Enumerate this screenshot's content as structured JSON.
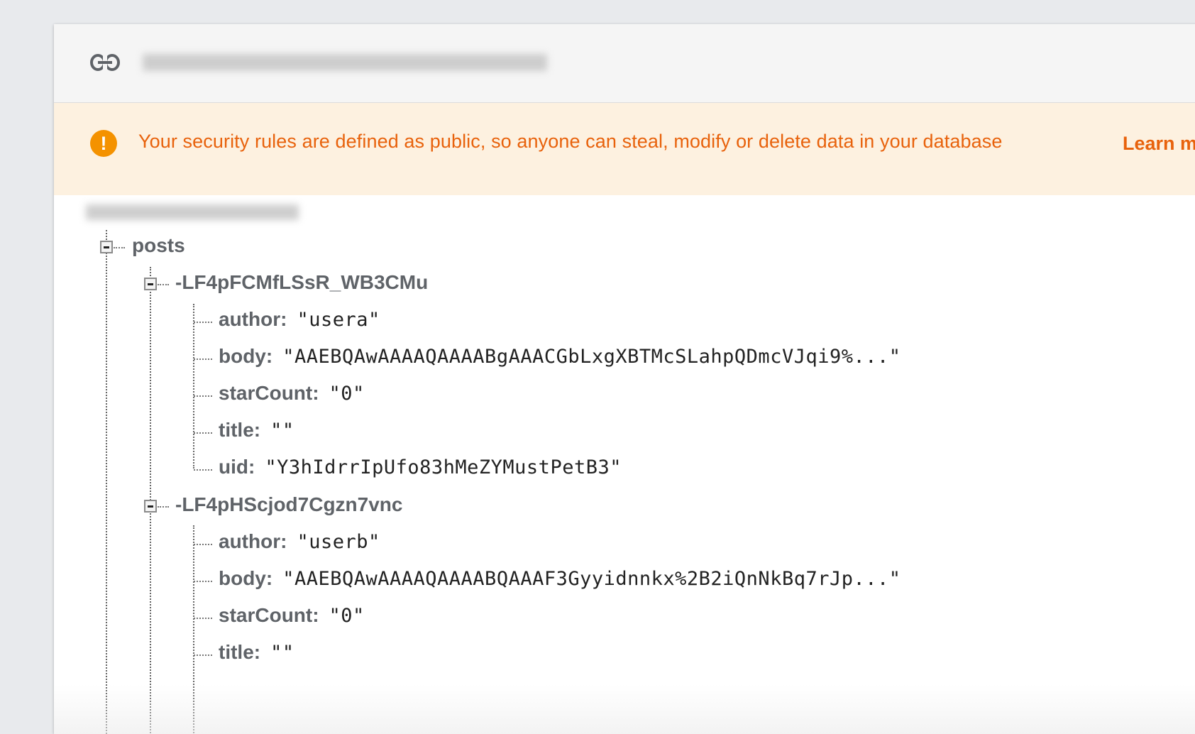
{
  "warning": {
    "icon": "exclamation-icon",
    "message": "Your security rules are defined as public, so anyone can steal, modify or delete data in your database",
    "learn_more": "Learn m",
    "color": "#e8620c",
    "background": "#fdf1e0",
    "icon_color": "#f49200"
  },
  "urlbar": {
    "icon": "link-icon"
  },
  "tree": {
    "root_child": "posts",
    "post1": {
      "key": "-LF4pFCMfLSsR_WB3CMu",
      "fields": [
        {
          "key": "author:",
          "value": "\"usera\""
        },
        {
          "key": "body:",
          "value": "\"AAEBQAwAAAAQAAAABgAAACGbLxgXBTMcSLahpQDmcVJqi9%...\""
        },
        {
          "key": "starCount:",
          "value": "\"0\""
        },
        {
          "key": "title:",
          "value": "\"\""
        },
        {
          "key": "uid:",
          "value": "\"Y3hIdrrIpUfo83hMeZYMustPetB3\""
        }
      ]
    },
    "post2": {
      "key": "-LF4pHScjod7Cgzn7vnc",
      "fields": [
        {
          "key": "author:",
          "value": "\"userb\""
        },
        {
          "key": "body:",
          "value": "\"AAEBQAwAAAAQAAAABQAAAF3Gyyidnnkx%2B2iQnNkBq7rJp...\""
        },
        {
          "key": "starCount:",
          "value": "\"0\""
        },
        {
          "key": "title:",
          "value": "\"\""
        }
      ]
    }
  }
}
